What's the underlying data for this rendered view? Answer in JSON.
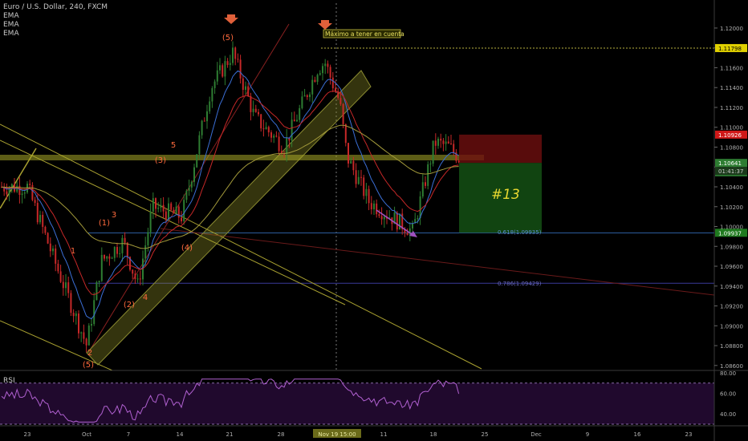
{
  "legend": {
    "symbol": "Euro / U.S. Dollar, 240, FXCM",
    "studies": [
      "EMA",
      "EMA",
      "EMA"
    ]
  },
  "rsi_label": "RSI",
  "annotation_text": "Máximo a tener en cuenta",
  "trade_label": "#13",
  "fib_labels": [
    "0.618(1.09935)",
    "0.786(1.09429)"
  ],
  "wave_labels": [
    "(1)",
    "(2)",
    "(3)",
    "(4)",
    "(5)",
    "1",
    "2",
    "3",
    "4",
    "5",
    "2",
    "(5)"
  ],
  "price_tags": [
    "1.11798",
    "1.10926",
    "1.10641",
    "01:41:37",
    "1.10611",
    "1.09937"
  ],
  "x_ticks": [
    "23",
    "Oct",
    "7",
    "14",
    "21",
    "28",
    "Nov",
    "11",
    "18",
    "25",
    "Dec",
    "9",
    "16",
    "23"
  ],
  "crosshair_date": "Nov 19  15:00",
  "rsi_ticks": [
    "80.00",
    "60.00",
    "40.00"
  ],
  "colors": {
    "up": "#2e7d32",
    "down": "#c62828",
    "ema_fast": "#3b6fd6",
    "ema_mid": "#c62828",
    "ema_slow": "#a39a3a",
    "wave": "#ff6a3d"
  },
  "chart_data": {
    "type": "candlestick",
    "title": "Euro / U.S. Dollar, 240, FXCM",
    "ylim": [
      1.0855,
      1.1225
    ],
    "y_ticks": [
      "1.12000",
      "1.11800",
      "1.11600",
      "1.11400",
      "1.11200",
      "1.11000",
      "1.10800",
      "1.10600",
      "1.10400",
      "1.10200",
      "1.10000",
      "1.09800",
      "1.09600",
      "1.09400",
      "1.09200",
      "1.09000",
      "1.08800",
      "1.08600"
    ],
    "x_categories": [
      "23",
      "Oct",
      "7",
      "14",
      "21",
      "28",
      "Nov",
      "11",
      "18",
      "25",
      "Dec",
      "9",
      "16",
      "23"
    ],
    "close_path": [
      [
        "Sep 23",
        1.104
      ],
      [
        "Sep 27",
        1.096
      ],
      [
        "Oct 1",
        1.088
      ],
      [
        "Oct 3",
        1.0965
      ],
      [
        "Oct 6",
        1.0985
      ],
      [
        "Oct 8",
        1.094
      ],
      [
        "Oct 10",
        1.102
      ],
      [
        "Oct 14",
        1.101
      ],
      [
        "Oct 15",
        1.104
      ],
      [
        "Oct 18",
        1.114
      ],
      [
        "Oct 21",
        1.1175
      ],
      [
        "Oct 24",
        1.111
      ],
      [
        "Oct 28",
        1.108
      ],
      [
        "Nov 1",
        1.116
      ],
      [
        "Nov 2",
        1.1165
      ],
      [
        "Nov 4",
        1.1125
      ],
      [
        "Nov 5",
        1.107
      ],
      [
        "Nov 8",
        1.1025
      ],
      [
        "Nov 12",
        1.1005
      ],
      [
        "Nov 14",
        1.0995
      ],
      [
        "Nov 15",
        1.1025
      ],
      [
        "Nov 17",
        1.1085
      ],
      [
        "Nov 19",
        1.108
      ],
      [
        "Nov 21",
        1.1064
      ]
    ],
    "price_lines": [
      {
        "label": "Máximo a tener en cuenta",
        "value": 1.11798
      },
      {
        "label": "0.618(1.09935)",
        "value": 1.09935
      },
      {
        "label": "0.786(1.09429)",
        "value": 1.09429
      }
    ],
    "trade": {
      "label": "#13",
      "entry": 1.10641,
      "stop": 1.10926,
      "target": 1.09937
    },
    "last_price": 1.10641,
    "rsi": {
      "ylim": [
        30,
        80
      ],
      "levels": [
        70,
        30
      ],
      "ticks": [
        "80.00",
        "60.00",
        "40.00"
      ]
    }
  }
}
